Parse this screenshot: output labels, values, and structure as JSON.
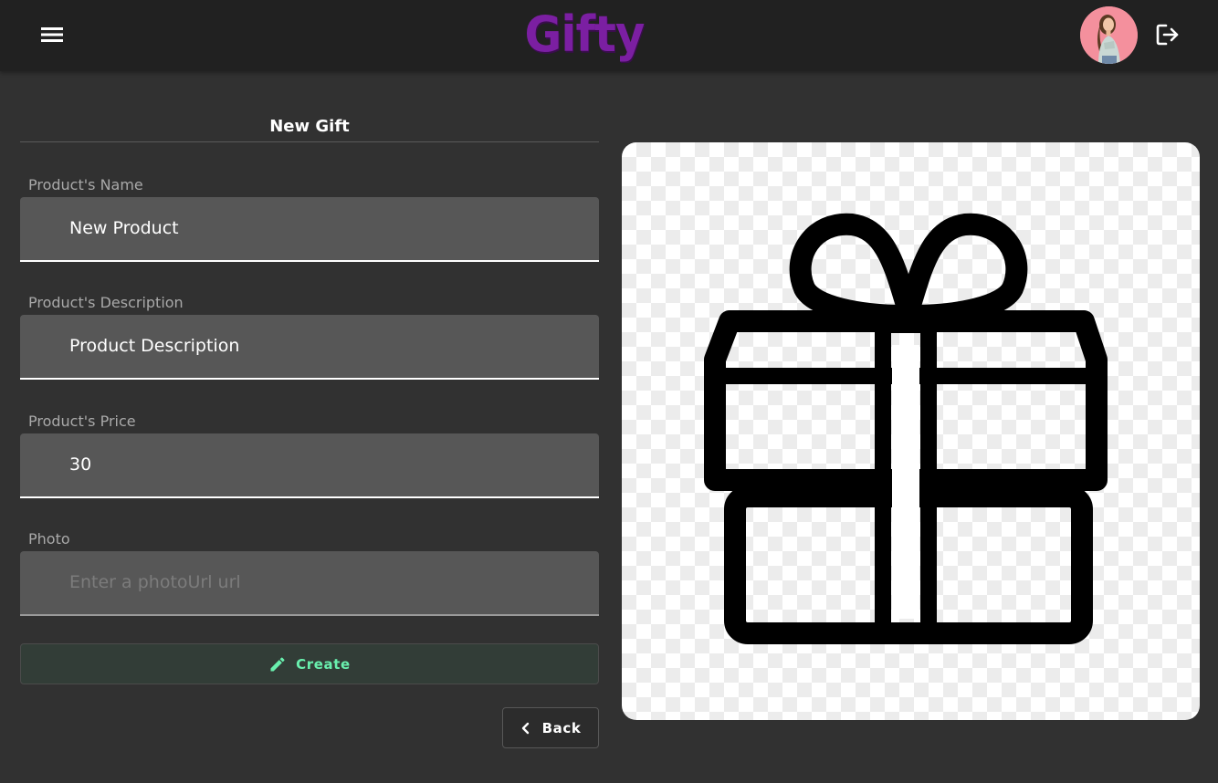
{
  "app": {
    "title": "Gifty"
  },
  "header": {
    "menu_icon": "hamburger-menu-icon",
    "avatar_alt": "user avatar",
    "logout_icon": "logout-icon"
  },
  "form": {
    "title": "New Gift",
    "fields": [
      {
        "label": "Product's Name",
        "value": "New Product",
        "placeholder": ""
      },
      {
        "label": "Product's Description",
        "value": "Product Description",
        "placeholder": ""
      },
      {
        "label": "Product's Price",
        "value": "30",
        "placeholder": ""
      },
      {
        "label": "Photo",
        "value": "",
        "placeholder": "Enter a photoUrl url"
      }
    ],
    "create_label": "Create",
    "create_icon": "pencil-icon",
    "back_label": "Back",
    "back_icon": "chevron-left-icon"
  },
  "preview": {
    "image": "gift-box-icon"
  },
  "colors": {
    "brand": "#7b1fa2",
    "accent_green": "#69f0ae",
    "topbar": "#212121",
    "background": "#313131",
    "field": "#575757"
  }
}
